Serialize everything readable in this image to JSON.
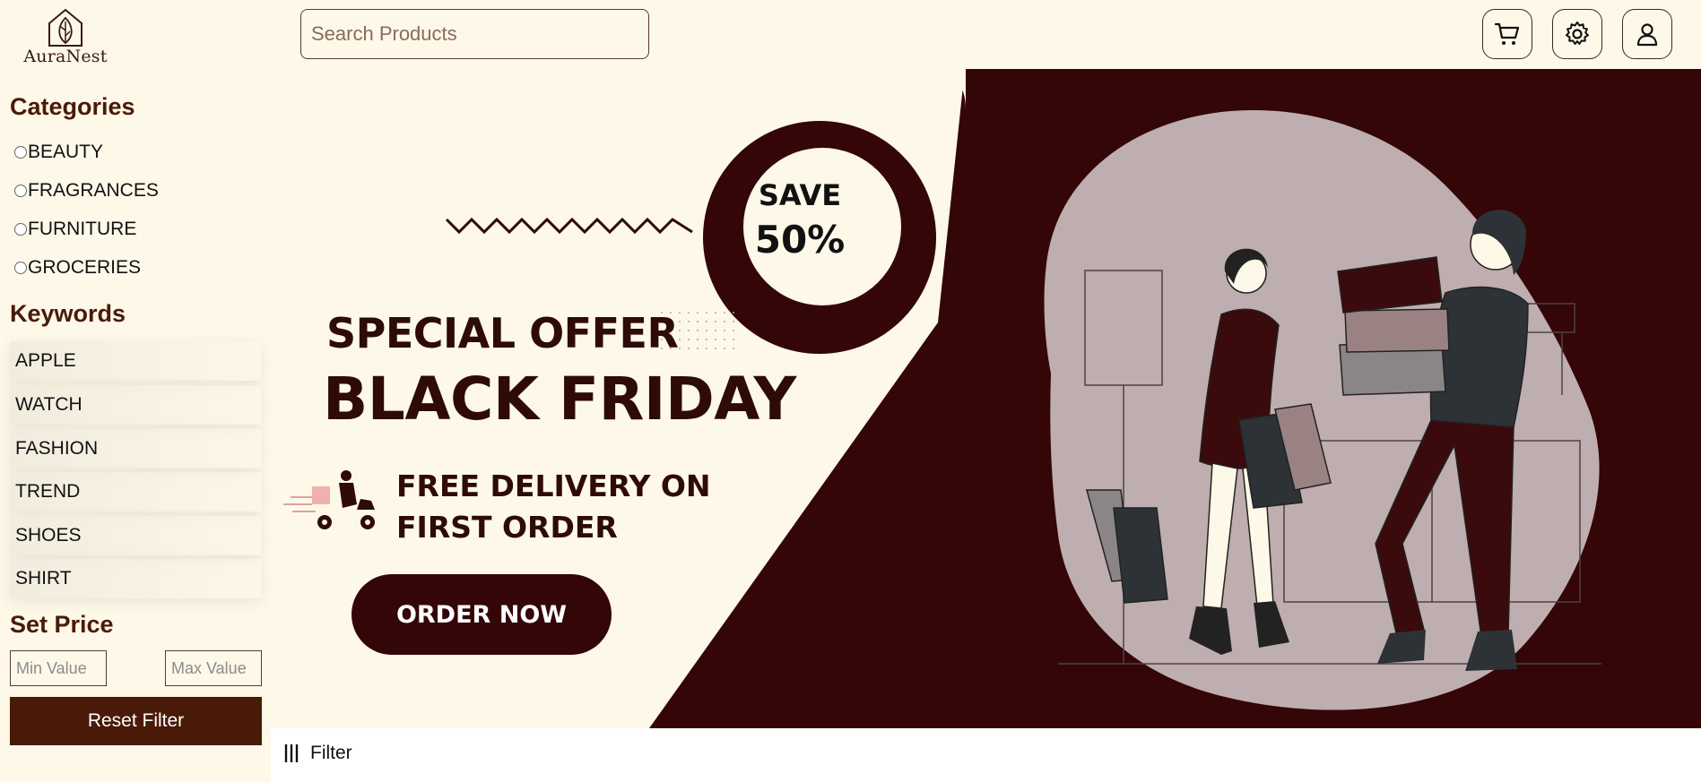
{
  "brand": {
    "name": "AuraNest",
    "icon": "leaf-house-logo"
  },
  "header": {
    "search_placeholder": "Search Products",
    "icons": [
      "cart-icon",
      "gear-icon",
      "user-icon"
    ]
  },
  "sidebar": {
    "categories_title": "Categories",
    "categories": [
      {
        "label": "BEAUTY",
        "checked": false
      },
      {
        "label": "FRAGRANCES",
        "checked": false
      },
      {
        "label": "FURNITURE",
        "checked": false
      },
      {
        "label": "GROCERIES",
        "checked": false
      }
    ],
    "keywords_title": "Keywords",
    "keywords": [
      "APPLE",
      "WATCH",
      "FASHION",
      "TREND",
      "SHOES",
      "SHIRT"
    ],
    "price_title": "Set Price",
    "min_placeholder": "Min Value",
    "max_placeholder": "Max Value",
    "reset_label": "Reset Filter"
  },
  "banner": {
    "save_label": "SAVE",
    "save_percent": "50%",
    "special_offer": "SPECIAL OFFER",
    "headline": "BLACK FRIDAY",
    "delivery_text": "FREE DELIVERY ON FIRST ORDER",
    "order_button": "ORDER NOW",
    "colors": {
      "dark": "#340607",
      "cream": "#fdf8e8",
      "blob": "#c0b0b0"
    }
  },
  "filter_bar": {
    "label": "Filter",
    "icon": "filter-bars-icon"
  }
}
